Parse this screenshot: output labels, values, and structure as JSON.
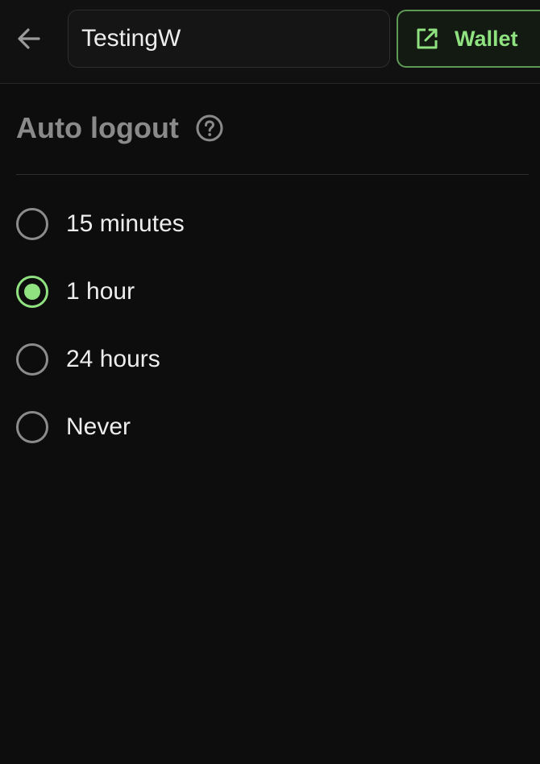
{
  "header": {
    "name_value": "TestingW",
    "wallet_label": "Wallet"
  },
  "section": {
    "title": "Auto logout"
  },
  "options": [
    {
      "label": "15 minutes",
      "selected": false
    },
    {
      "label": "1 hour",
      "selected": true
    },
    {
      "label": "24 hours",
      "selected": false
    },
    {
      "label": "Never",
      "selected": false
    }
  ],
  "colors": {
    "accent": "#8fe27f",
    "background": "#0d0d0d",
    "muted": "#8a8a8a"
  }
}
